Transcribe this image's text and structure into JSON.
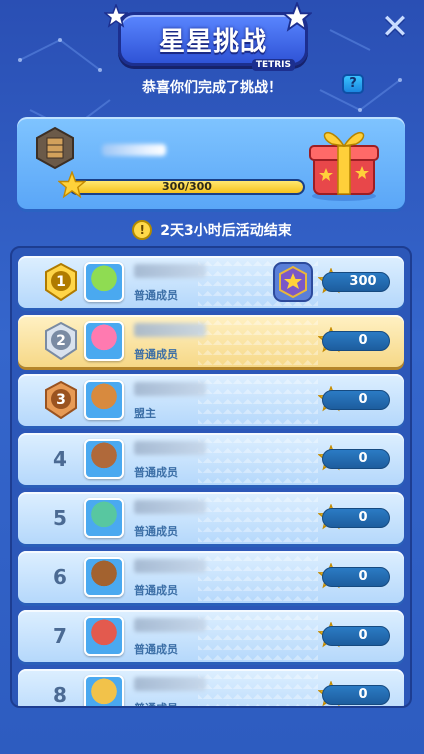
{
  "header": {
    "title": "星星挑战",
    "subtitle": "TETRIS",
    "congrats": "恭喜你们完成了挑战！",
    "help_label": "?",
    "close_label": "✕"
  },
  "progress": {
    "current": 300,
    "total": 300,
    "label": "300/300",
    "fraction": 1.0
  },
  "timer": {
    "text": "2天3小时后活动结束",
    "icon": "!"
  },
  "leaderboard": [
    {
      "rank": "1",
      "role": "普通成员",
      "score": "300",
      "avatar_color": "#8fdc52",
      "medal": "gold",
      "highlight": false,
      "badge": true
    },
    {
      "rank": "2",
      "role": "普通成员",
      "score": "0",
      "avatar_color": "#ff7ab0",
      "medal": "silver",
      "highlight": true,
      "badge": false
    },
    {
      "rank": "3",
      "role": "盟主",
      "score": "0",
      "avatar_color": "#d88a3e",
      "medal": "bronze",
      "highlight": false,
      "badge": false
    },
    {
      "rank": "4",
      "role": "普通成员",
      "score": "0",
      "avatar_color": "#b0693a",
      "medal": "",
      "highlight": false,
      "badge": false
    },
    {
      "rank": "5",
      "role": "普通成员",
      "score": "0",
      "avatar_color": "#58c7a0",
      "medal": "",
      "highlight": false,
      "badge": false
    },
    {
      "rank": "6",
      "role": "普通成员",
      "score": "0",
      "avatar_color": "#a3622f",
      "medal": "",
      "highlight": false,
      "badge": false
    },
    {
      "rank": "7",
      "role": "普通成员",
      "score": "0",
      "avatar_color": "#e35a4e",
      "medal": "",
      "highlight": false,
      "badge": false
    },
    {
      "rank": "8",
      "role": "普通成员",
      "score": "0",
      "avatar_color": "#f2c24a",
      "medal": "",
      "highlight": false,
      "badge": false
    }
  ],
  "colors": {
    "background": "#3566cc",
    "star": "#ffd23a",
    "bar_fill": "#f6c21c"
  }
}
